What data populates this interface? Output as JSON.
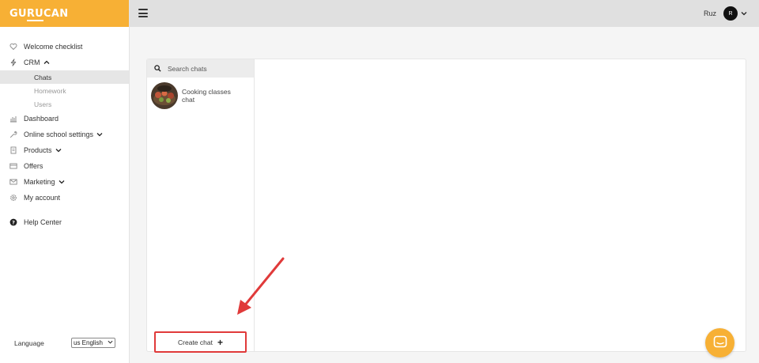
{
  "brand": {
    "logo_parts": [
      "GU",
      "RU",
      "CAN"
    ],
    "color": "#f7b035"
  },
  "sidebar": {
    "items": [
      {
        "label": "Welcome checklist",
        "icon": "heart-icon"
      },
      {
        "label": "CRM",
        "icon": "bolt-icon",
        "expanded": true,
        "children": [
          {
            "label": "Chats",
            "active": true
          },
          {
            "label": "Homework"
          },
          {
            "label": "Users"
          }
        ]
      },
      {
        "label": "Dashboard",
        "icon": "bar-chart-icon"
      },
      {
        "label": "Online school settings",
        "icon": "wrench-icon",
        "expandable": true
      },
      {
        "label": "Products",
        "icon": "document-icon",
        "expandable": true
      },
      {
        "label": "Offers",
        "icon": "credit-card-icon"
      },
      {
        "label": "Marketing",
        "icon": "mail-icon",
        "expandable": true
      },
      {
        "label": "My account",
        "icon": "gear-icon"
      }
    ],
    "help": {
      "label": "Help Center",
      "icon": "question-circle-icon"
    },
    "language": {
      "label": "Language",
      "selected": "us English"
    }
  },
  "topbar": {
    "user_name": "Ruz",
    "avatar_initial": "R"
  },
  "chats": {
    "search_placeholder": "Search chats",
    "items": [
      {
        "title": "Cooking classes chat"
      }
    ],
    "create_label": "Create chat"
  },
  "colors": {
    "accent": "#f7b035",
    "highlight": "#e03a3a"
  }
}
